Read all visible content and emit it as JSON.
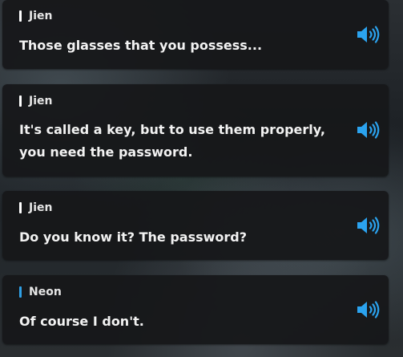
{
  "colors": {
    "jien_bar": "#ffffff",
    "neon_bar": "#2fa0e6",
    "voice_icon": "#2ba3ef"
  },
  "entries": [
    {
      "speaker": "Jien",
      "text": "Those glasses that you possess...",
      "voice_icon": "speaker-volume-icon"
    },
    {
      "speaker": "Jien",
      "text": "It's called a key, but to use them properly, you need the password.",
      "voice_icon": "speaker-volume-icon"
    },
    {
      "speaker": "Jien",
      "text": "Do you know it? The password?",
      "voice_icon": "speaker-volume-icon"
    },
    {
      "speaker": "Neon",
      "text": "Of course I don't.",
      "voice_icon": "speaker-volume-icon"
    }
  ]
}
